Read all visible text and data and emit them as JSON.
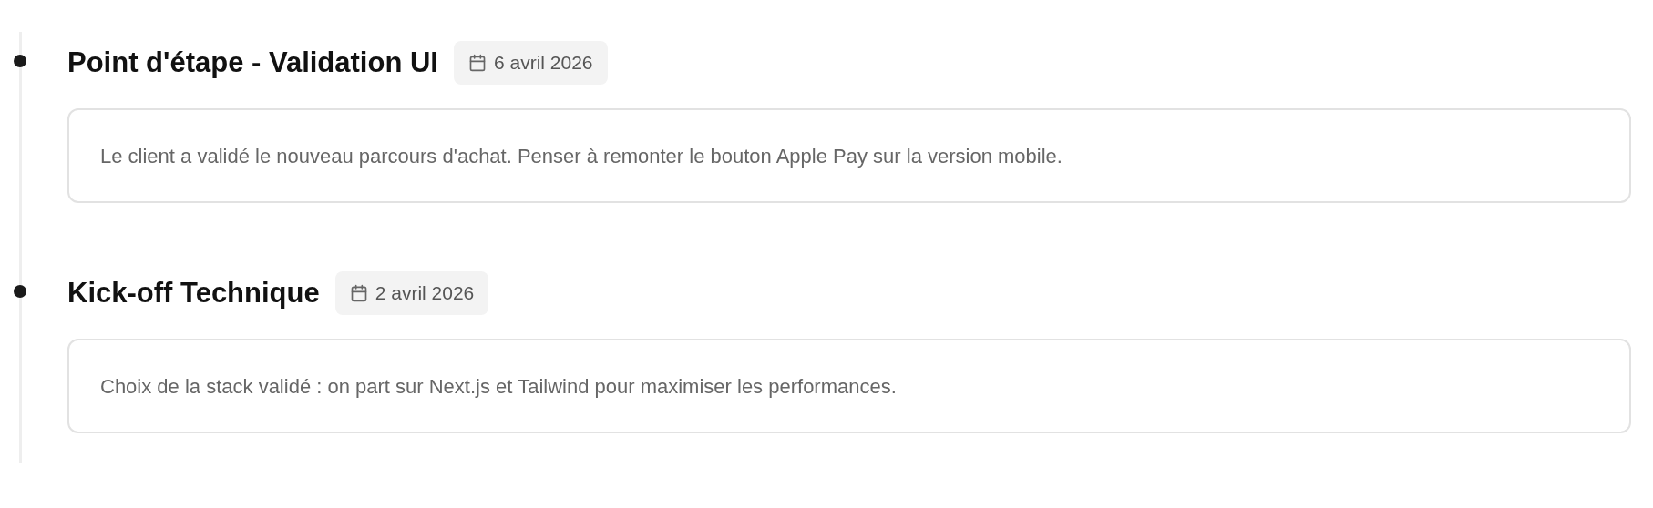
{
  "timeline": [
    {
      "title": "Point d'étape - Validation UI",
      "date": "6 avril 2026",
      "note": "Le client a validé le nouveau parcours d'achat. Penser à remonter le bouton Apple Pay sur la version mobile."
    },
    {
      "title": "Kick-off Technique",
      "date": "2 avril 2026",
      "note": "Choix de la stack validé : on part sur Next.js et Tailwind pour maximiser les performances."
    }
  ]
}
